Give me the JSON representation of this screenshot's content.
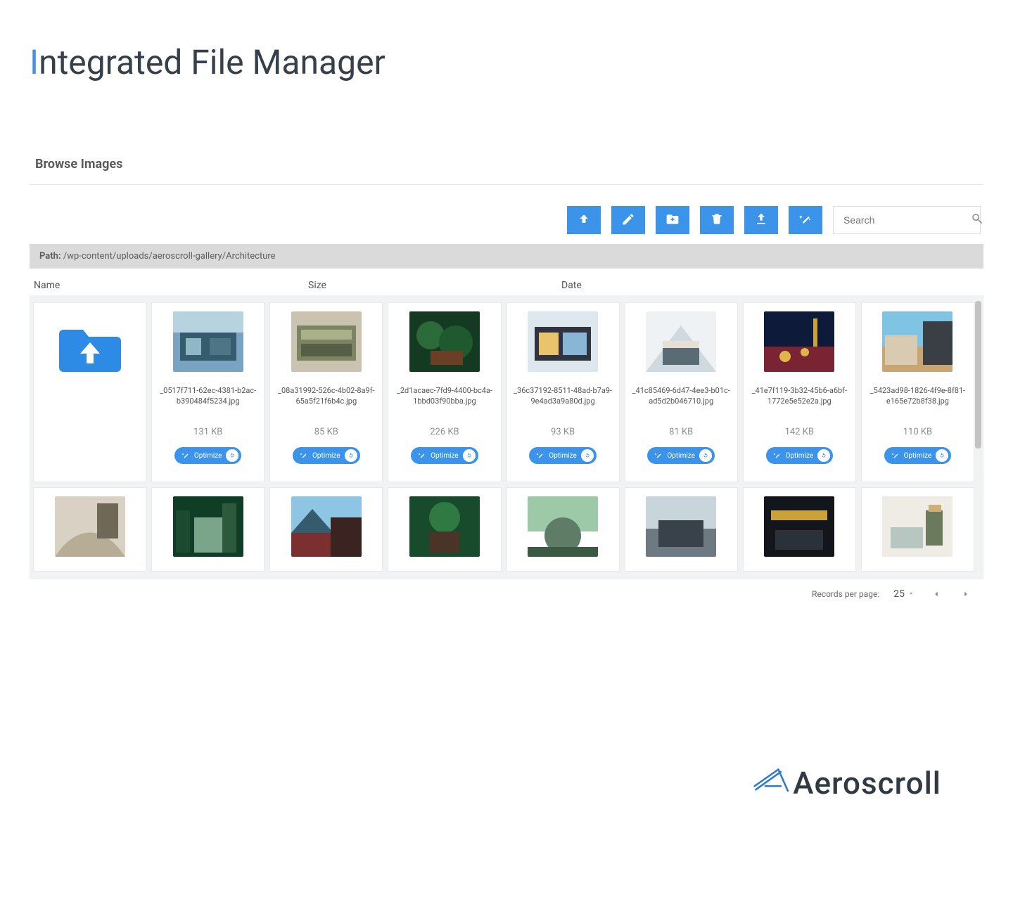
{
  "title_first_letter": "I",
  "title_rest": "ntegrated File Manager",
  "section_title": "Browse Images",
  "search_placeholder": "Search",
  "path_label": "Path:",
  "path_value": "/wp-content/uploads/aeroscroll-gallery/Architecture",
  "columns": {
    "name": "Name",
    "size": "Size",
    "date": "Date"
  },
  "optimize_label": "Optimize",
  "files": [
    {
      "name": "_0517f711-62ec-4381-b2ac-b390484f5234.jpg",
      "size": "131 KB"
    },
    {
      "name": "_08a31992-526c-4b02-8a9f-65a5f21f6b4c.jpg",
      "size": "85 KB"
    },
    {
      "name": "_2d1acaec-7fd9-4400-bc4a-1bbd03f90bba.jpg",
      "size": "226 KB"
    },
    {
      "name": "_36c37192-8511-48ad-b7a9-9e4ad3a9a80d.jpg",
      "size": "93 KB"
    },
    {
      "name": "_41c85469-6d47-4ee3-b01c-ad5d2b046710.jpg",
      "size": "81 KB"
    },
    {
      "name": "_41e7f119-3b32-45b6-a6bf-1772e5e52e2a.jpg",
      "size": "142 KB"
    },
    {
      "name": "_5423ad98-1826-4f9e-8f81-e165e72b8f38.jpg",
      "size": "110 KB"
    }
  ],
  "pager": {
    "label": "Records per page:",
    "value": "25"
  },
  "brand": "Aeroscroll"
}
